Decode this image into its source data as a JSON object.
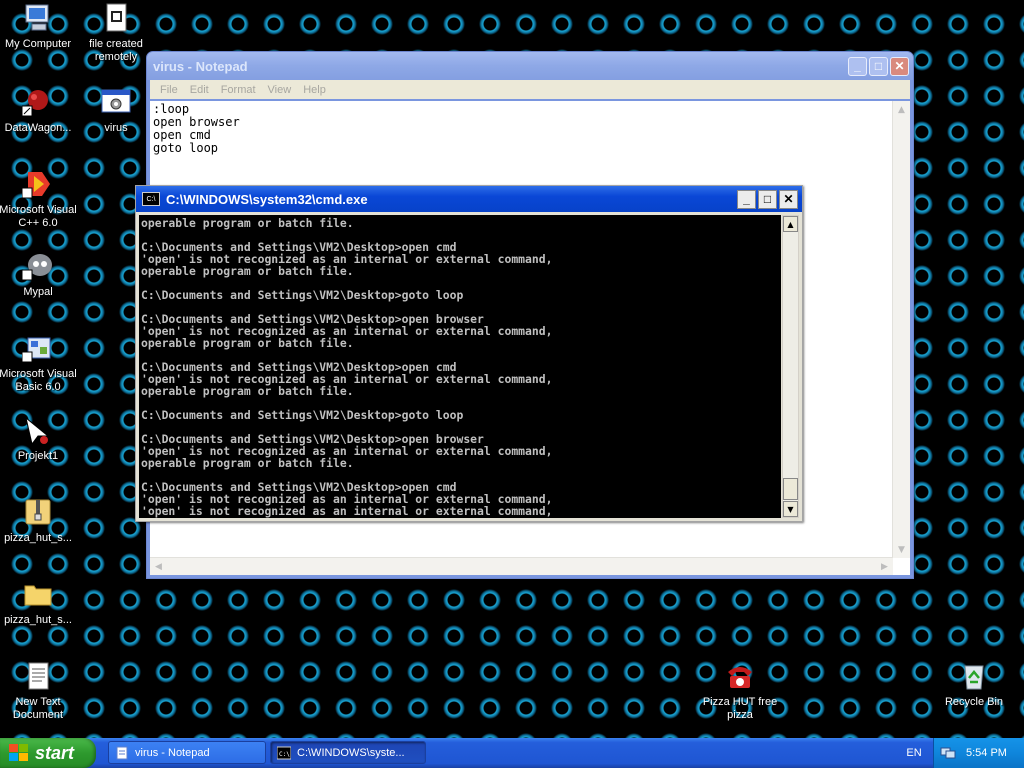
{
  "desktop": {
    "icons_left": [
      {
        "label": "My Computer",
        "icon": "computer-icon"
      },
      {
        "label": "DataWagon...",
        "icon": "datawagon-icon"
      },
      {
        "label": "Microsoft Visual C++ 6.0",
        "icon": "visual-cpp-icon"
      },
      {
        "label": "Mypal",
        "icon": "mypal-browser-icon"
      },
      {
        "label": "Microsoft Visual Basic 6.0",
        "icon": "visual-basic-icon"
      },
      {
        "label": "Projekt1",
        "icon": "projekt-icon"
      },
      {
        "label": "pizza_hut_s...",
        "icon": "zip-folder-icon"
      },
      {
        "label": "pizza_hut_s...",
        "icon": "folder-icon"
      },
      {
        "label": "New Text Document",
        "icon": "text-document-icon"
      }
    ],
    "icons_other": [
      {
        "label": "file created remotely",
        "icon": "document-icon"
      },
      {
        "label": "virus",
        "icon": "batch-file-icon"
      },
      {
        "label": "Pizza HUT free pizza",
        "icon": "telephone-icon"
      },
      {
        "label": "Recycle Bin",
        "icon": "recycle-bin-icon"
      }
    ]
  },
  "notepad": {
    "title": "virus - Notepad",
    "menu": [
      "File",
      "Edit",
      "Format",
      "View",
      "Help"
    ],
    "content": ":loop\nopen browser\nopen cmd\ngoto loop"
  },
  "cmd": {
    "title": "C:\\WINDOWS\\system32\\cmd.exe",
    "output": "operable program or batch file.\n\nC:\\Documents and Settings\\VM2\\Desktop>open cmd\n'open' is not recognized as an internal or external command,\noperable program or batch file.\n\nC:\\Documents and Settings\\VM2\\Desktop>goto loop\n\nC:\\Documents and Settings\\VM2\\Desktop>open browser\n'open' is not recognized as an internal or external command,\noperable program or batch file.\n\nC:\\Documents and Settings\\VM2\\Desktop>open cmd\n'open' is not recognized as an internal or external command,\noperable program or batch file.\n\nC:\\Documents and Settings\\VM2\\Desktop>goto loop\n\nC:\\Documents and Settings\\VM2\\Desktop>open browser\n'open' is not recognized as an internal or external command,\noperable program or batch file.\n\nC:\\Documents and Settings\\VM2\\Desktop>open cmd\n'open' is not recognized as an internal or external command,\n'open' is not recognized as an internal or external command,"
  },
  "taskbar": {
    "start_label": "start",
    "tasks": [
      {
        "label": "virus - Notepad",
        "icon": "notepad-icon",
        "state": "normal"
      },
      {
        "label": "C:\\WINDOWS\\syste...",
        "icon": "cmd-icon",
        "state": "pressed"
      }
    ],
    "language": "EN",
    "clock": "5:54 PM"
  },
  "colors": {
    "desktop_bg": "#000000",
    "ring_accent": "#1aa7d6",
    "taskbar_blue": "#245edb",
    "start_green": "#2e9a2e"
  }
}
